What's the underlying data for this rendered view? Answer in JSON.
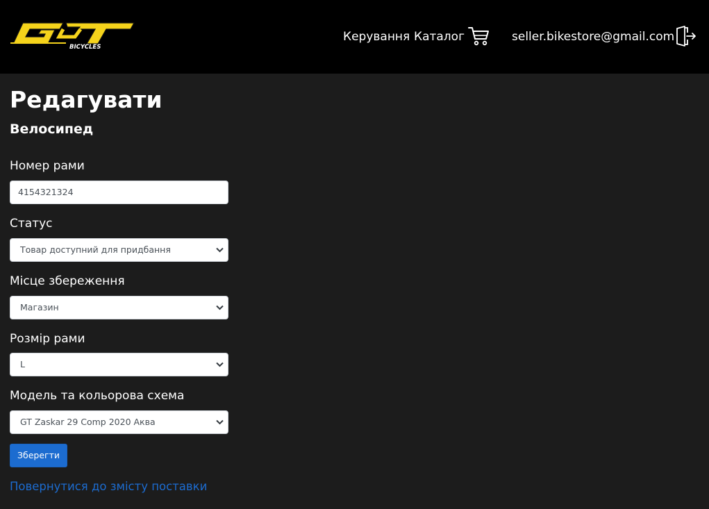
{
  "header": {
    "logo_text": "GT BICYCLES",
    "nav": {
      "manage_label": "Керування",
      "catalog_label": "Каталог",
      "user_email": "seller.bikestore@gmail.com"
    },
    "icons": {
      "cart": "cart-icon",
      "logout": "logout-icon"
    }
  },
  "page": {
    "title": "Редагувати",
    "subtitle": "Велосипед"
  },
  "form": {
    "frame_number": {
      "label": "Номер рами",
      "value": "4154321324"
    },
    "status": {
      "label": "Статус",
      "value": "Товар доступний для придбання"
    },
    "storage": {
      "label": "Місце збереження",
      "value": "Магазин"
    },
    "frame_size": {
      "label": "Розмір рами",
      "value": "L"
    },
    "model": {
      "label": "Модель та кольорова схема",
      "value": "GT Zaskar 29 Comp 2020 Аква"
    },
    "save_label": "Зберегти"
  },
  "back_link_label": "Повернутися до змісту поставки",
  "colors": {
    "navbar": "#000000",
    "background": "#1c1c1c",
    "accent": "#1c6cd0",
    "logo_yellow": "#f5d31b"
  }
}
